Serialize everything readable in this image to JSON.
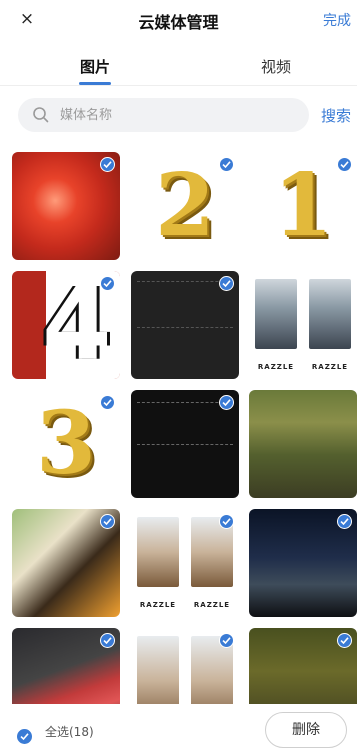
{
  "header": {
    "title": "云媒体管理",
    "done_label": "完成",
    "close_icon": "×"
  },
  "tabs": [
    {
      "label": "图片",
      "active": true
    },
    {
      "label": "视频",
      "active": false
    }
  ],
  "search": {
    "placeholder": "媒体名称",
    "value": "",
    "button_label": "搜索"
  },
  "grid": {
    "tiles": [
      {
        "kind": "photo-red-flower",
        "selected": true
      },
      {
        "kind": "gold-number",
        "text": "2",
        "selected": true
      },
      {
        "kind": "gold-number",
        "text": "1",
        "selected": true
      },
      {
        "kind": "red-number",
        "text": "4",
        "selected": true
      },
      {
        "kind": "dark-frame",
        "selected": true
      },
      {
        "kind": "fashion-photo",
        "caption": "RAZZLE",
        "selected": false
      },
      {
        "kind": "gold-number",
        "text": "3",
        "selected": true
      },
      {
        "kind": "black-frame",
        "selected": true
      },
      {
        "kind": "photo-forest-stream",
        "selected": false
      },
      {
        "kind": "photo-butterfly",
        "selected": true
      },
      {
        "kind": "fashion-photo-light",
        "caption": "RAZZLE",
        "selected": true
      },
      {
        "kind": "photo-night-sky",
        "selected": true
      },
      {
        "kind": "photo-keyboard",
        "selected": true
      },
      {
        "kind": "fashion-photo-standing",
        "selected": true
      },
      {
        "kind": "photo-forest-floor",
        "selected": true
      }
    ]
  },
  "bottom": {
    "select_all_label": "全选(18)",
    "select_all_checked": true,
    "delete_label": "删除"
  },
  "colors": {
    "accent": "#3a7bd5",
    "search_bg": "#f1f2f4"
  }
}
